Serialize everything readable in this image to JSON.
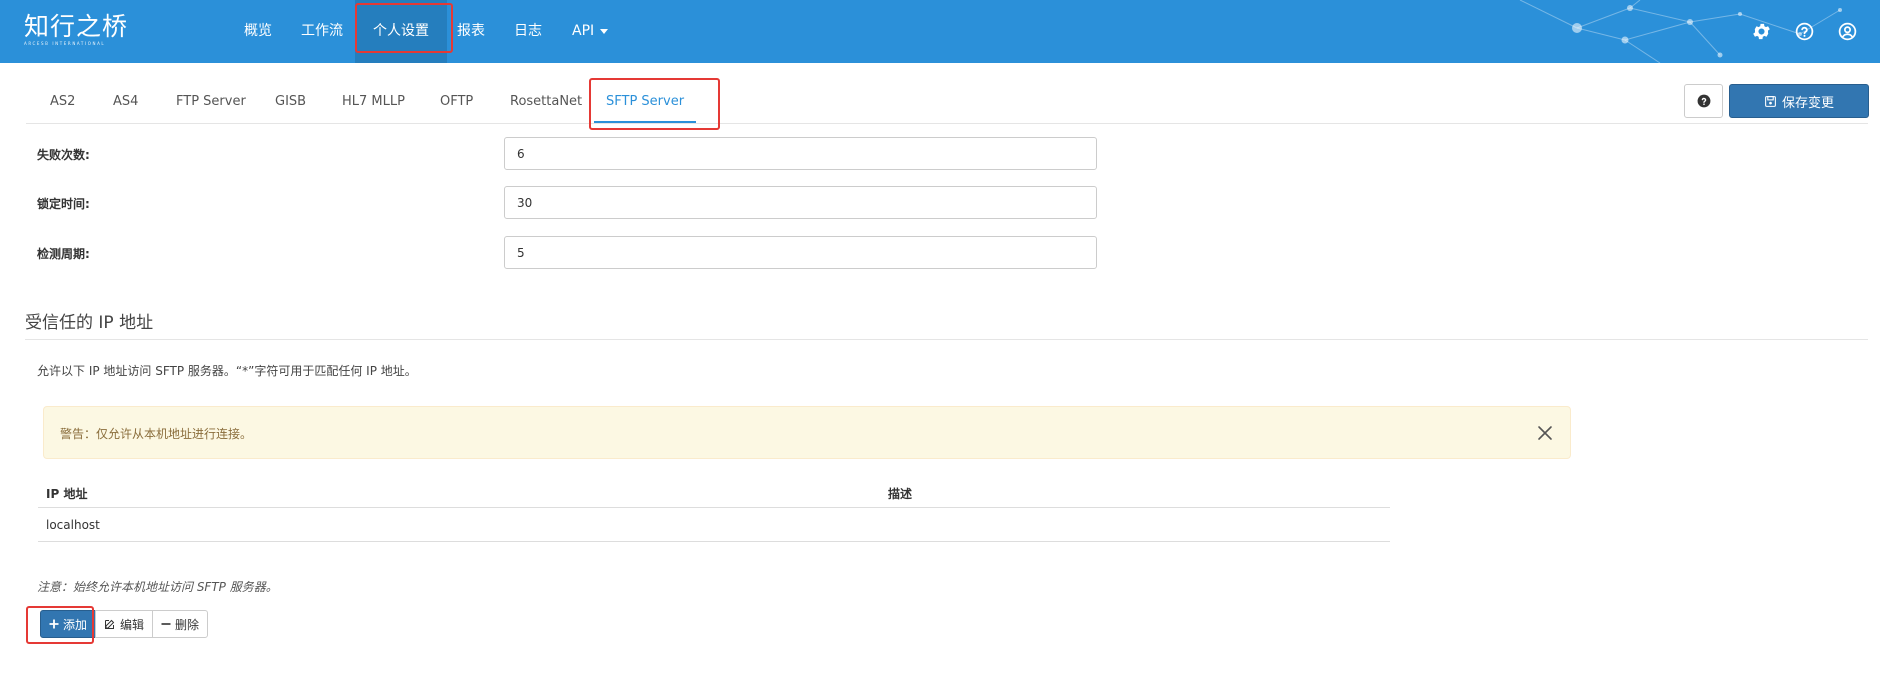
{
  "brand": {
    "logo_text": "知行之桥",
    "logo_sub": "ARCESB INTERNATIONAL"
  },
  "nav": {
    "items": [
      {
        "label": "概览"
      },
      {
        "label": "工作流"
      },
      {
        "label": "个人设置",
        "active": true
      },
      {
        "label": "报表"
      },
      {
        "label": "日志"
      },
      {
        "label": "API"
      }
    ],
    "icons": [
      "gear-icon",
      "help-circle-icon",
      "user-circle-icon"
    ]
  },
  "tabs": [
    {
      "label": "AS2"
    },
    {
      "label": "AS4"
    },
    {
      "label": "FTP Server"
    },
    {
      "label": "GISB"
    },
    {
      "label": "HL7 MLLP"
    },
    {
      "label": "OFTP"
    },
    {
      "label": "RosettaNet"
    },
    {
      "label": "SFTP Server",
      "active": true
    }
  ],
  "toolbar": {
    "help_icon": "question-circle-icon",
    "save_label": "保存变更",
    "save_icon": "save-icon"
  },
  "form": {
    "fields": [
      {
        "label": "失败次数:",
        "value": "6"
      },
      {
        "label": "锁定时间:",
        "value": "30"
      },
      {
        "label": "检测周期:",
        "value": "5"
      }
    ]
  },
  "trusted_ip": {
    "title": "受信任的 IP 地址",
    "description": "允许以下 IP 地址访问 SFTP 服务器。“*”字符可用于匹配任何 IP 地址。",
    "alert": "警告：仅允许从本机地址进行连接。",
    "table": {
      "headers": [
        "IP 地址",
        "描述"
      ],
      "rows": [
        [
          "localhost",
          ""
        ]
      ]
    },
    "note": "注意：始终允许本机地址访问 SFTP 服务器。",
    "buttons": {
      "add": "添加",
      "edit": "编辑",
      "delete": "删除"
    }
  },
  "colors": {
    "navbar": "#2b90d9",
    "accent": "#2b90d9",
    "primary_button": "#3276b1",
    "alert_bg": "#fcf8e3",
    "highlight": "#e53935"
  }
}
